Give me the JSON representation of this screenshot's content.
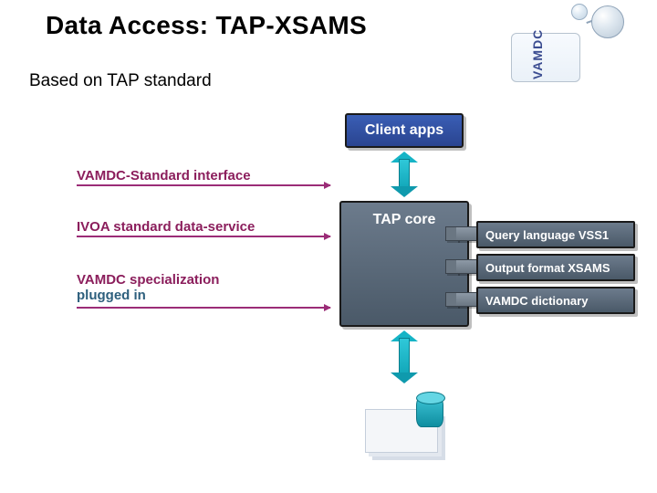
{
  "title": "Data Access: TAP-XSAMS",
  "subtitle": "Based on TAP standard",
  "logo": {
    "text": "VAMDC"
  },
  "annotations": {
    "a1": "VAMDC-Standard interface",
    "a2": "IVOA standard data-service",
    "a3_line1": "VAMDC specialization",
    "a3_line2": "plugged in"
  },
  "blocks": {
    "client": "Client apps",
    "tap_core": "TAP core"
  },
  "tags": {
    "t1": "Query language VSS1",
    "t2": "Output format XSAMS",
    "t3": "VAMDC dictionary"
  }
}
